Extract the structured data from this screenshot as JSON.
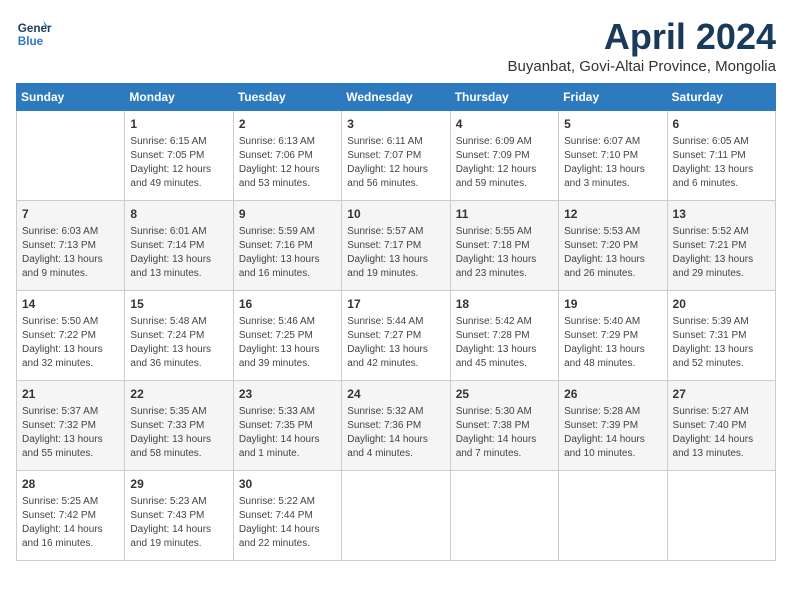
{
  "logo": {
    "line1": "General",
    "line2": "Blue"
  },
  "title": "April 2024",
  "subtitle": "Buyanbat, Govi-Altai Province, Mongolia",
  "days_of_week": [
    "Sunday",
    "Monday",
    "Tuesday",
    "Wednesday",
    "Thursday",
    "Friday",
    "Saturday"
  ],
  "weeks": [
    [
      {
        "day": "",
        "info": ""
      },
      {
        "day": "1",
        "info": "Sunrise: 6:15 AM\nSunset: 7:05 PM\nDaylight: 12 hours\nand 49 minutes."
      },
      {
        "day": "2",
        "info": "Sunrise: 6:13 AM\nSunset: 7:06 PM\nDaylight: 12 hours\nand 53 minutes."
      },
      {
        "day": "3",
        "info": "Sunrise: 6:11 AM\nSunset: 7:07 PM\nDaylight: 12 hours\nand 56 minutes."
      },
      {
        "day": "4",
        "info": "Sunrise: 6:09 AM\nSunset: 7:09 PM\nDaylight: 12 hours\nand 59 minutes."
      },
      {
        "day": "5",
        "info": "Sunrise: 6:07 AM\nSunset: 7:10 PM\nDaylight: 13 hours\nand 3 minutes."
      },
      {
        "day": "6",
        "info": "Sunrise: 6:05 AM\nSunset: 7:11 PM\nDaylight: 13 hours\nand 6 minutes."
      }
    ],
    [
      {
        "day": "7",
        "info": "Sunrise: 6:03 AM\nSunset: 7:13 PM\nDaylight: 13 hours\nand 9 minutes."
      },
      {
        "day": "8",
        "info": "Sunrise: 6:01 AM\nSunset: 7:14 PM\nDaylight: 13 hours\nand 13 minutes."
      },
      {
        "day": "9",
        "info": "Sunrise: 5:59 AM\nSunset: 7:16 PM\nDaylight: 13 hours\nand 16 minutes."
      },
      {
        "day": "10",
        "info": "Sunrise: 5:57 AM\nSunset: 7:17 PM\nDaylight: 13 hours\nand 19 minutes."
      },
      {
        "day": "11",
        "info": "Sunrise: 5:55 AM\nSunset: 7:18 PM\nDaylight: 13 hours\nand 23 minutes."
      },
      {
        "day": "12",
        "info": "Sunrise: 5:53 AM\nSunset: 7:20 PM\nDaylight: 13 hours\nand 26 minutes."
      },
      {
        "day": "13",
        "info": "Sunrise: 5:52 AM\nSunset: 7:21 PM\nDaylight: 13 hours\nand 29 minutes."
      }
    ],
    [
      {
        "day": "14",
        "info": "Sunrise: 5:50 AM\nSunset: 7:22 PM\nDaylight: 13 hours\nand 32 minutes."
      },
      {
        "day": "15",
        "info": "Sunrise: 5:48 AM\nSunset: 7:24 PM\nDaylight: 13 hours\nand 36 minutes."
      },
      {
        "day": "16",
        "info": "Sunrise: 5:46 AM\nSunset: 7:25 PM\nDaylight: 13 hours\nand 39 minutes."
      },
      {
        "day": "17",
        "info": "Sunrise: 5:44 AM\nSunset: 7:27 PM\nDaylight: 13 hours\nand 42 minutes."
      },
      {
        "day": "18",
        "info": "Sunrise: 5:42 AM\nSunset: 7:28 PM\nDaylight: 13 hours\nand 45 minutes."
      },
      {
        "day": "19",
        "info": "Sunrise: 5:40 AM\nSunset: 7:29 PM\nDaylight: 13 hours\nand 48 minutes."
      },
      {
        "day": "20",
        "info": "Sunrise: 5:39 AM\nSunset: 7:31 PM\nDaylight: 13 hours\nand 52 minutes."
      }
    ],
    [
      {
        "day": "21",
        "info": "Sunrise: 5:37 AM\nSunset: 7:32 PM\nDaylight: 13 hours\nand 55 minutes."
      },
      {
        "day": "22",
        "info": "Sunrise: 5:35 AM\nSunset: 7:33 PM\nDaylight: 13 hours\nand 58 minutes."
      },
      {
        "day": "23",
        "info": "Sunrise: 5:33 AM\nSunset: 7:35 PM\nDaylight: 14 hours\nand 1 minute."
      },
      {
        "day": "24",
        "info": "Sunrise: 5:32 AM\nSunset: 7:36 PM\nDaylight: 14 hours\nand 4 minutes."
      },
      {
        "day": "25",
        "info": "Sunrise: 5:30 AM\nSunset: 7:38 PM\nDaylight: 14 hours\nand 7 minutes."
      },
      {
        "day": "26",
        "info": "Sunrise: 5:28 AM\nSunset: 7:39 PM\nDaylight: 14 hours\nand 10 minutes."
      },
      {
        "day": "27",
        "info": "Sunrise: 5:27 AM\nSunset: 7:40 PM\nDaylight: 14 hours\nand 13 minutes."
      }
    ],
    [
      {
        "day": "28",
        "info": "Sunrise: 5:25 AM\nSunset: 7:42 PM\nDaylight: 14 hours\nand 16 minutes."
      },
      {
        "day": "29",
        "info": "Sunrise: 5:23 AM\nSunset: 7:43 PM\nDaylight: 14 hours\nand 19 minutes."
      },
      {
        "day": "30",
        "info": "Sunrise: 5:22 AM\nSunset: 7:44 PM\nDaylight: 14 hours\nand 22 minutes."
      },
      {
        "day": "",
        "info": ""
      },
      {
        "day": "",
        "info": ""
      },
      {
        "day": "",
        "info": ""
      },
      {
        "day": "",
        "info": ""
      }
    ]
  ]
}
